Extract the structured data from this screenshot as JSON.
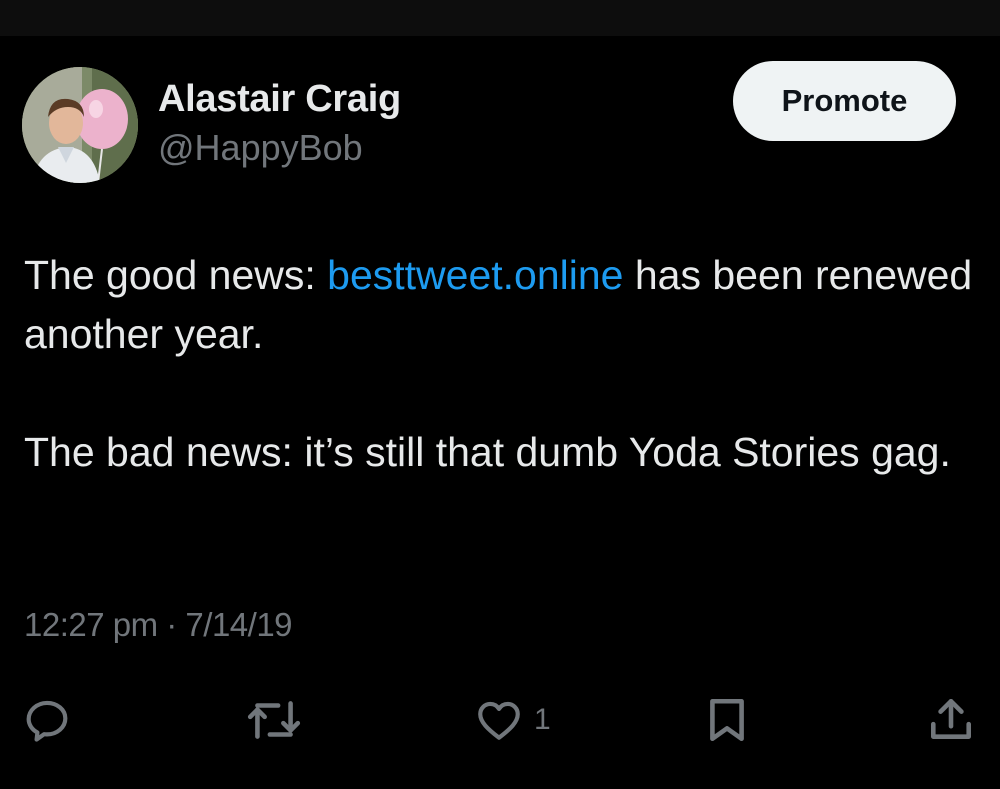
{
  "tweet": {
    "author": {
      "display_name": "Alastair Craig",
      "handle": "@HappyBob"
    },
    "promote_label": "Promote",
    "text": {
      "p1_before_link": "The good news: ",
      "p1_link": "besttweet.online",
      "p1_after_link": " has been renewed another year.",
      "p2": "The bad news: it’s still that dumb Yoda Stories gag."
    },
    "time": "12:27 pm",
    "separator": " · ",
    "date": "7/14/19",
    "actions": {
      "reply": {
        "icon": "reply-icon"
      },
      "retweet": {
        "icon": "retweet-icon"
      },
      "like": {
        "icon": "heart-icon",
        "count": "1"
      },
      "bookmark": {
        "icon": "bookmark-icon"
      },
      "share": {
        "icon": "share-icon"
      }
    }
  },
  "colors": {
    "background": "#000000",
    "text_primary": "#e7e9ea",
    "text_secondary": "#71767b",
    "link": "#1d9bf0",
    "button_bg": "#eff3f4",
    "button_text": "#0f1419"
  }
}
